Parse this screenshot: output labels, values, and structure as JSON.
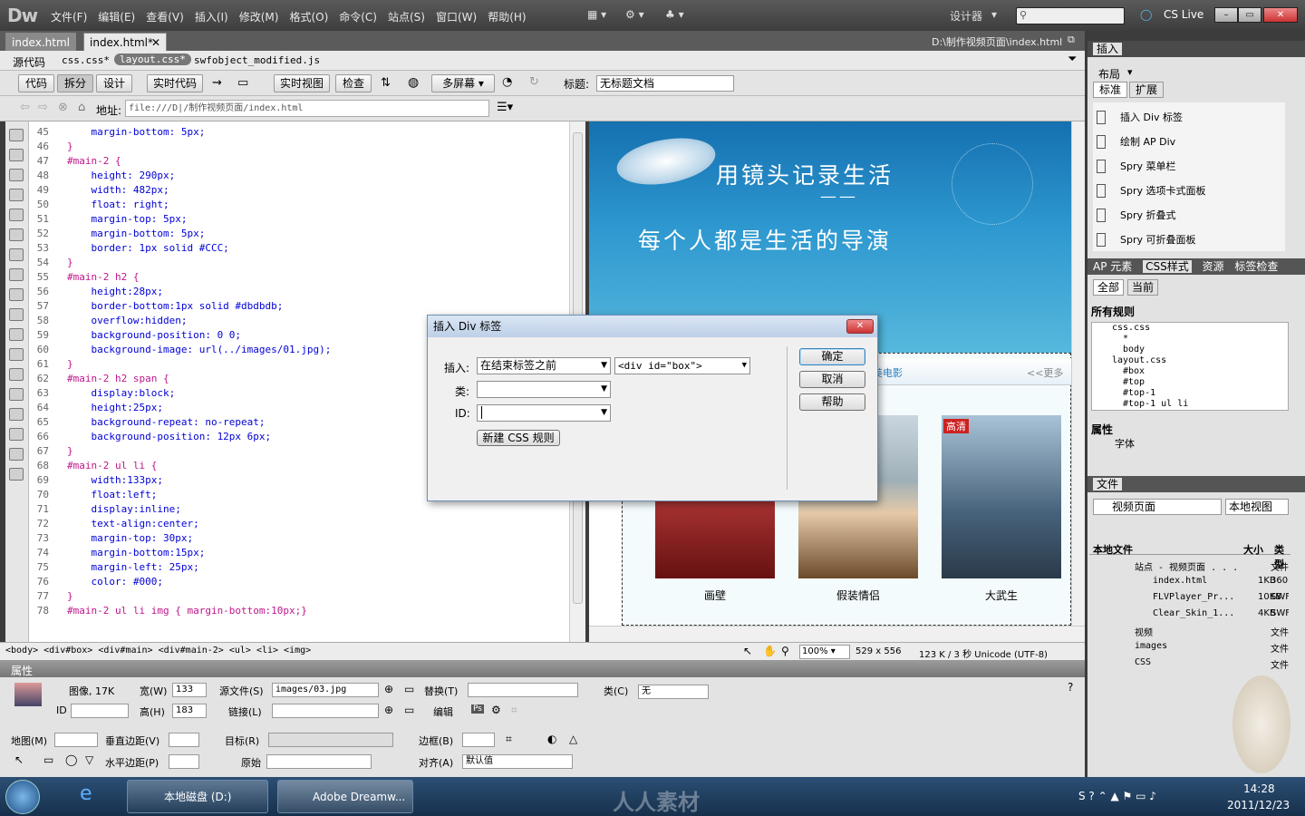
{
  "menubar": {
    "logo": "Dw",
    "items": [
      "文件(F)",
      "编辑(E)",
      "查看(V)",
      "插入(I)",
      "修改(M)",
      "格式(O)",
      "命令(C)",
      "站点(S)",
      "窗口(W)",
      "帮助(H)"
    ],
    "workspace": "设计器",
    "cslive": "CS Live"
  },
  "tabs": {
    "doc1": "index.html",
    "doc2": "index.html*",
    "path": "D:\\制作视频页面\\index.html"
  },
  "related": {
    "source": "源代码",
    "files": [
      "css.css*",
      "layout.css*",
      "swfobject_modified.js"
    ]
  },
  "toolbar": {
    "code": "代码",
    "split": "拆分",
    "design": "设计",
    "live_code": "实时代码",
    "live_view": "实时视图",
    "inspect": "检查",
    "multiscreen": "多屏幕",
    "title_label": "标题:",
    "title_value": "无标题文档"
  },
  "address": {
    "label": "地址:",
    "value": "file:///D|/制作视频页面/index.html"
  },
  "code": {
    "lines": [
      {
        "n": "45",
        "t": "    margin-bottom: 5px;",
        "k": "p"
      },
      {
        "n": "46",
        "t": "}",
        "k": "b"
      },
      {
        "n": "47",
        "t": "#main-2 {",
        "k": "s"
      },
      {
        "n": "48",
        "t": "    height: 290px;",
        "k": "p"
      },
      {
        "n": "49",
        "t": "    width: 482px;",
        "k": "p"
      },
      {
        "n": "50",
        "t": "    float: right;",
        "k": "p"
      },
      {
        "n": "51",
        "t": "    margin-top: 5px;",
        "k": "p"
      },
      {
        "n": "52",
        "t": "    margin-bottom: 5px;",
        "k": "p"
      },
      {
        "n": "53",
        "t": "    border: 1px solid #CCC;",
        "k": "p"
      },
      {
        "n": "54",
        "t": "}",
        "k": "b"
      },
      {
        "n": "55",
        "t": "#main-2 h2 {",
        "k": "s"
      },
      {
        "n": "56",
        "t": "    height:28px;",
        "k": "p"
      },
      {
        "n": "57",
        "t": "    border-bottom:1px solid #dbdbdb;",
        "k": "p"
      },
      {
        "n": "58",
        "t": "    overflow:hidden;",
        "k": "p"
      },
      {
        "n": "59",
        "t": "    background-position: 0 0;",
        "k": "p"
      },
      {
        "n": "60",
        "t": "    background-image: url(../images/01.jpg);",
        "k": "p"
      },
      {
        "n": "61",
        "t": "}",
        "k": "b"
      },
      {
        "n": "62",
        "t": "#main-2 h2 span {",
        "k": "s"
      },
      {
        "n": "63",
        "t": "    display:block;",
        "k": "p"
      },
      {
        "n": "64",
        "t": "    height:25px;",
        "k": "p"
      },
      {
        "n": "65",
        "t": "    background-repeat: no-repeat;",
        "k": "p"
      },
      {
        "n": "66",
        "t": "    background-position: 12px 6px;",
        "k": "p"
      },
      {
        "n": "67",
        "t": "}",
        "k": "b"
      },
      {
        "n": "68",
        "t": "#main-2 ul li {",
        "k": "s"
      },
      {
        "n": "69",
        "t": "    width:133px;",
        "k": "p"
      },
      {
        "n": "70",
        "t": "    float:left;",
        "k": "p"
      },
      {
        "n": "71",
        "t": "    display:inline;",
        "k": "p"
      },
      {
        "n": "72",
        "t": "    text-align:center;",
        "k": "p"
      },
      {
        "n": "73",
        "t": "    margin-top: 30px;",
        "k": "p"
      },
      {
        "n": "74",
        "t": "    margin-bottom:15px;",
        "k": "p"
      },
      {
        "n": "75",
        "t": "    margin-left: 25px;",
        "k": "p"
      },
      {
        "n": "76",
        "t": "    color: #000;",
        "k": "p"
      },
      {
        "n": "77",
        "t": "}",
        "k": "b"
      },
      {
        "n": "78",
        "t": "#main-2 ul li img { margin-bottom:10px;}",
        "k": "s"
      }
    ]
  },
  "design": {
    "banner_line1": "用镜头记录生活",
    "banner_dash": "——",
    "banner_line2": "每个人都是生活的导演",
    "section_title": "美电影",
    "more": "<<更多",
    "badge": "高清",
    "movies": [
      "画壁",
      "假装情侣",
      "大武生"
    ]
  },
  "status": {
    "tags": "<body> <div#box> <div#main> <div#main-2> <ul> <li> <img>",
    "zoom": "100%",
    "size": "529 x 556",
    "info": "123 K / 3 秒 Unicode (UTF-8)"
  },
  "dialog": {
    "title": "插入 Div 标签",
    "insert_label": "插入:",
    "insert_value": "在结束标签之前",
    "target_value": "<div id=\"box\">",
    "class_label": "类:",
    "id_label": "ID:",
    "new_css": "新建 CSS 规则",
    "ok": "确定",
    "cancel": "取消",
    "help": "帮助"
  },
  "insert_panel": {
    "title": "插入",
    "category": "布局",
    "tab_std": "标准",
    "tab_ext": "扩展",
    "items": [
      "插入 Div 标签",
      "绘制 AP Div",
      "Spry 菜单栏",
      "Spry 选项卡式面板",
      "Spry 折叠式",
      "Spry 可折叠面板"
    ]
  },
  "css_panel": {
    "tabs": [
      "AP 元素",
      "CSS样式",
      "资源",
      "标签检查"
    ],
    "all": "全部",
    "current": "当前",
    "rules_title": "所有规则",
    "rules": [
      "css.css",
      "*",
      "body",
      "layout.css",
      "#box",
      "#top",
      "#top-1",
      "#top-1 ul li"
    ],
    "props_title": "属性",
    "props_font": "字体"
  },
  "files_panel": {
    "title": "文件",
    "site": "视频页面",
    "view": "本地视图",
    "col_local": "本地文件",
    "col_size": "大小",
    "col_type": "类型",
    "items": [
      {
        "name": "站点 - 视频页面 . . .",
        "size": "",
        "type": "文件"
      },
      {
        "name": "index.html",
        "size": "1KB",
        "type": "360"
      },
      {
        "name": "FLVPlayer_Pr...",
        "size": "10KB",
        "type": "SWF"
      },
      {
        "name": "Clear_Skin_1...",
        "size": "4KB",
        "type": "SWF"
      },
      {
        "name": "视频",
        "size": "",
        "type": "文件"
      },
      {
        "name": "images",
        "size": "",
        "type": "文件"
      },
      {
        "name": "CSS",
        "size": "",
        "type": "文件"
      }
    ]
  },
  "props": {
    "title": "属性",
    "image_label": "图像, 17K",
    "width_label": "宽(W)",
    "width": "133",
    "height_label": "高(H)",
    "height": "183",
    "src_label": "源文件(S)",
    "src": "images/03.jpg",
    "link_label": "链接(L)",
    "alt_label": "替换(T)",
    "edit_label": "编辑",
    "class_label": "类(C)",
    "class_value": "无",
    "id_label": "ID",
    "map_label": "地图(M)",
    "vspace_label": "垂直边距(V)",
    "hspace_label": "水平边距(P)",
    "target_label": "目标(R)",
    "original_label": "原始",
    "border_label": "边框(B)",
    "align_label": "对齐(A)",
    "align_value": "默认值"
  },
  "taskbar": {
    "item1": "本地磁盘 (D:)",
    "item2": "Adobe Dreamw...",
    "watermark": "人人素材",
    "time": "14:28",
    "date": "2011/12/23"
  }
}
